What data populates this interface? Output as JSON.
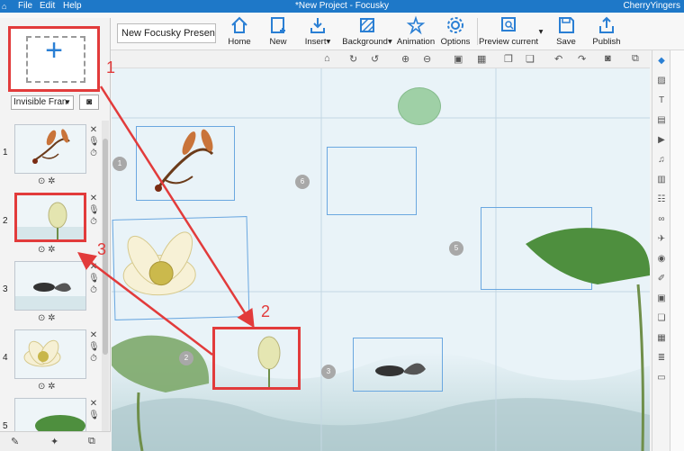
{
  "titlebar": {
    "menus": [
      "File",
      "Edit",
      "Help"
    ],
    "title": "*New Project - Focusky",
    "user": "CherryYingers"
  },
  "toolbar": {
    "project_name": "New Focusky Presenta",
    "buttons": [
      "Home",
      "New",
      "Insert",
      "Background",
      "Animation",
      "Options",
      "Preview current",
      "Save",
      "Publish"
    ]
  },
  "left_panel": {
    "add_frame_symbol": "+",
    "frame_type": "Invisible Fran",
    "frames": [
      {
        "num": "1"
      },
      {
        "num": "2"
      },
      {
        "num": "3"
      },
      {
        "num": "4"
      },
      {
        "num": "5"
      }
    ]
  },
  "canvas": {
    "path_badges": [
      "6",
      "5",
      "2",
      "3"
    ]
  },
  "annotations": [
    "1",
    "2",
    "3"
  ],
  "colors": {
    "accent": "#1e78c8",
    "annotation": "#e23b3b",
    "frame_outline": "#6aa7e0"
  }
}
